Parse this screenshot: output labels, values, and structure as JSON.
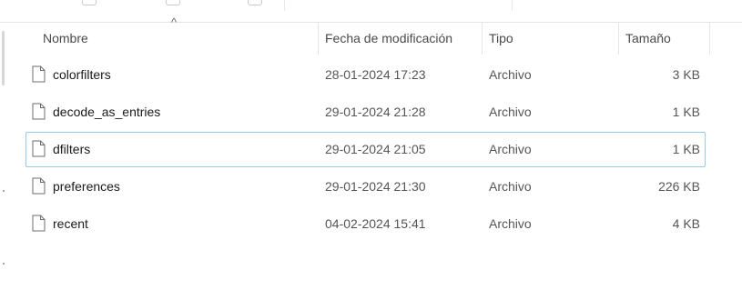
{
  "columns": {
    "name": "Nombre",
    "date": "Fecha de modificación",
    "type": "Tipo",
    "size": "Tamaño"
  },
  "sort": {
    "column": "name",
    "direction": "ascending"
  },
  "files": [
    {
      "name": "colorfilters",
      "date": "28-01-2024 17:23",
      "type": "Archivo",
      "size": "3 KB"
    },
    {
      "name": "decode_as_entries",
      "date": "29-01-2024 21:28",
      "type": "Archivo",
      "size": "1 KB"
    },
    {
      "name": "dfilters",
      "date": "29-01-2024 21:05",
      "type": "Archivo",
      "size": "1 KB"
    },
    {
      "name": "preferences",
      "date": "29-01-2024 21:30",
      "type": "Archivo",
      "size": "226 KB"
    },
    {
      "name": "recent",
      "date": "04-02-2024 15:41",
      "type": "Archivo",
      "size": "4 KB"
    }
  ],
  "focused_row": 2,
  "icons": {
    "file": "file-icon",
    "sort": "sort-up-icon"
  },
  "colors": {
    "focus_border": "#99c8e8",
    "header_text": "#4a4a4a",
    "secondary_text": "#555555"
  }
}
